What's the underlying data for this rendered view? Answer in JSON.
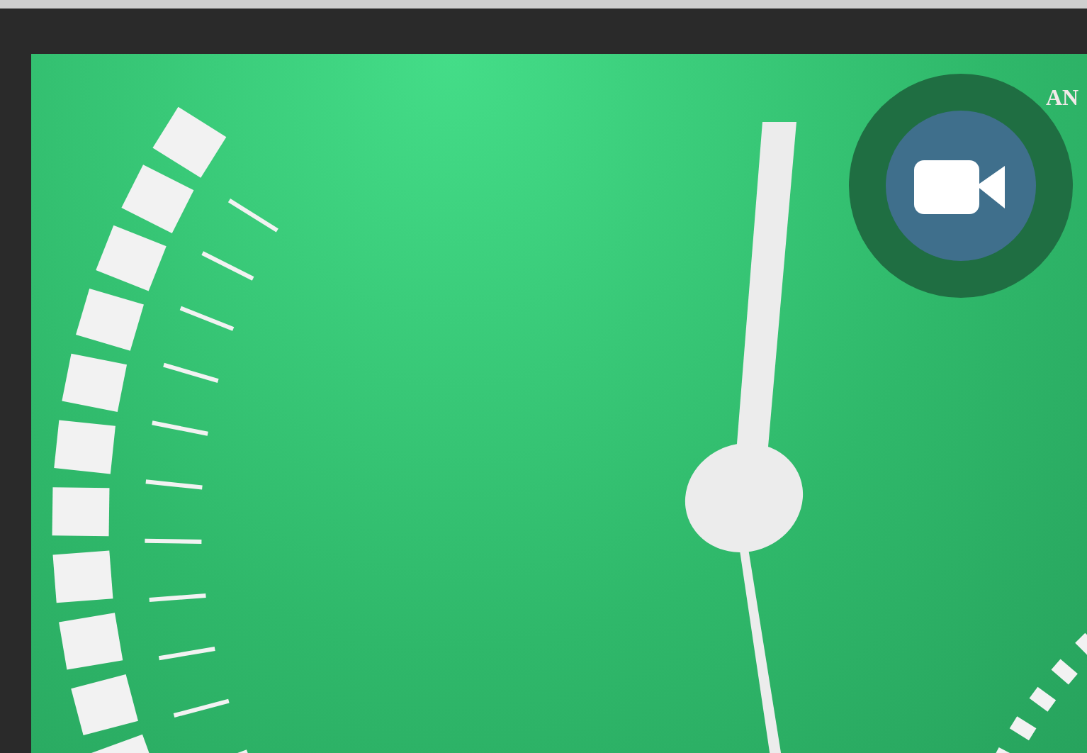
{
  "corner_text": "AN"
}
